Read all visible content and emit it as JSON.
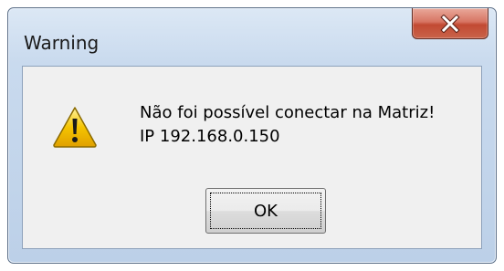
{
  "window": {
    "title": "Warning"
  },
  "message": {
    "line1": "Não foi possível conectar na Matriz!",
    "line2": "IP 192.168.0.150"
  },
  "buttons": {
    "ok_label": "OK"
  },
  "icons": {
    "close": "close-icon",
    "warning": "warning-icon"
  },
  "colors": {
    "close_button": "#c24a33",
    "warning_yellow": "#f5c400",
    "client_bg": "#f0f0f0"
  }
}
